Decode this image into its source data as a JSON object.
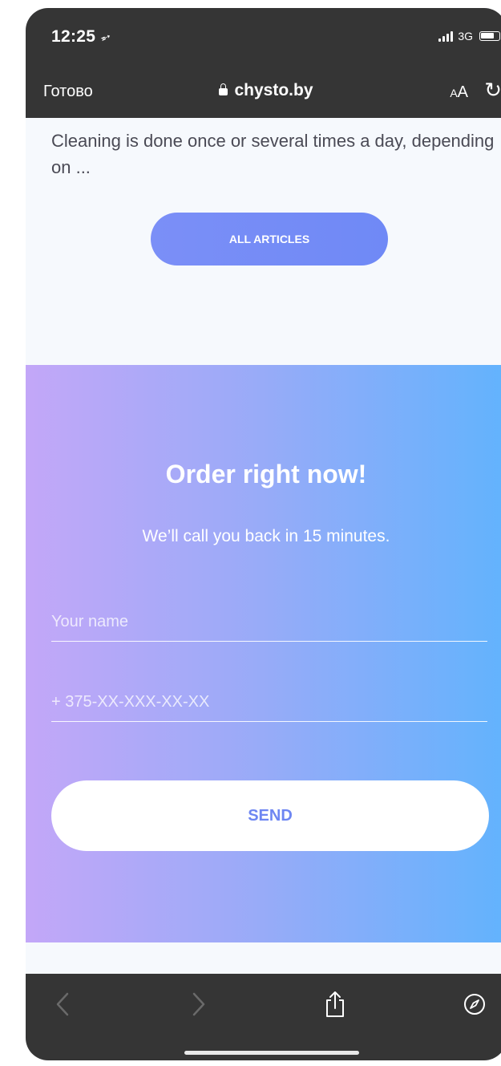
{
  "status_bar": {
    "time": "12:25",
    "location_icon": "location-arrow-icon",
    "network": "3G",
    "signal_icon": "cellular-signal-icon",
    "battery_icon": "battery-icon"
  },
  "browser_bar": {
    "done_label": "Готово",
    "url": "chysto.by",
    "text_size_small": "A",
    "text_size_large": "A",
    "reload_icon": "reload-icon",
    "lock_icon": "lock-icon"
  },
  "article": {
    "excerpt": "Cleaning is done once or several times a day, depending on ..."
  },
  "all_articles_button": {
    "label": "ALL ARTICLES",
    "color": "#7088f6"
  },
  "order": {
    "title": "Order right now!",
    "subtitle": "We’ll call you back in 15 minutes.",
    "name_placeholder": "Your name",
    "phone_placeholder": "+ 375-XX-XXX-XX-XX",
    "send_label": "SEND",
    "gradient_start": "#c3a7f8",
    "gradient_end": "#62b3fd"
  },
  "toolbar": {
    "back_icon": "chevron-left-icon",
    "forward_icon": "chevron-right-icon",
    "share_icon": "share-icon",
    "compass_icon": "compass-icon"
  },
  "theme": {
    "chrome_background": "#353535",
    "page_background": "#f6f9fd"
  }
}
